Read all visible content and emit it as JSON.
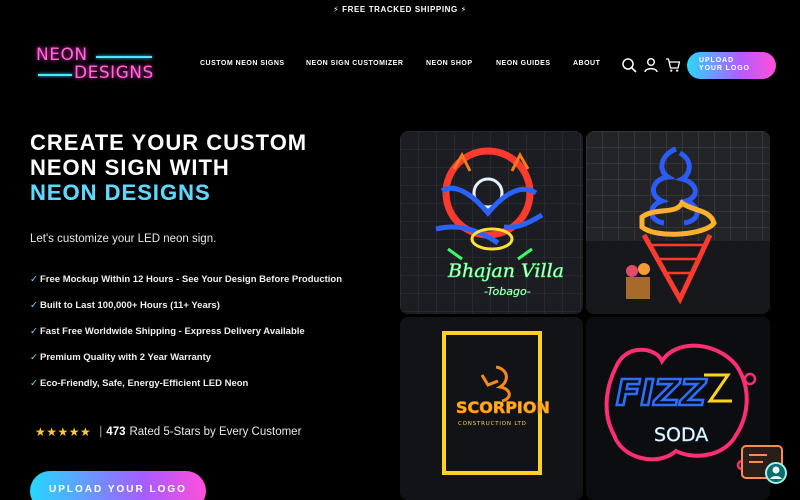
{
  "announcement": "⚡ FREE TRACKED SHIPPING ⚡",
  "logo": {
    "line1": "NEON",
    "line2": "DESIGNS"
  },
  "nav": {
    "items": [
      {
        "label": "CUSTOM NEON SIGNS"
      },
      {
        "label": "NEON SIGN CUSTOMIZER"
      },
      {
        "label": "NEON SHOP"
      },
      {
        "label": "NEON GUIDES"
      },
      {
        "label": "ABOUT"
      }
    ],
    "icons": [
      "search-icon",
      "account-icon",
      "cart-icon"
    ],
    "cta_line1": "UPLOAD",
    "cta_line2": "YOUR LOGO"
  },
  "hero": {
    "title_line1": "CREATE YOUR CUSTOM",
    "title_line2": "NEON SIGN WITH",
    "title_line3": "NEON DESIGNS",
    "tagline": "Let's customize your LED neon sign.",
    "features": [
      "Free Mockup Within 12 Hours - See Your Design Before Production",
      "Built to Last 100,000+ Hours (11+ Years)",
      "Fast Free Worldwide Shipping - Express Delivery Available",
      "Premium Quality with 2 Year Warranty",
      "Eco-Friendly, Safe, Energy-Efficient LED Neon"
    ],
    "check": "✓",
    "rating": {
      "stars": "★★★★★",
      "separator": "|",
      "count": "473",
      "text": "Rated 5-Stars by Every Customer"
    },
    "cta": "UPLOAD YOUR LOGO"
  },
  "gallery": {
    "tile1": {
      "text_main": "Bhajan Villa",
      "text_sub": "-Tobago-"
    },
    "tile2": {},
    "tile3": {
      "text_main": "SCORPION",
      "text_sub": "CONSTRUCTION LTD"
    },
    "tile4": {
      "text_main": "FIZZ",
      "text_sub": "SODA"
    }
  },
  "colors": {
    "accent_cyan": "#4ee6ff",
    "accent_pink": "#ff4fd8",
    "accent_purple": "#a75cff",
    "star": "#ffc93a"
  }
}
